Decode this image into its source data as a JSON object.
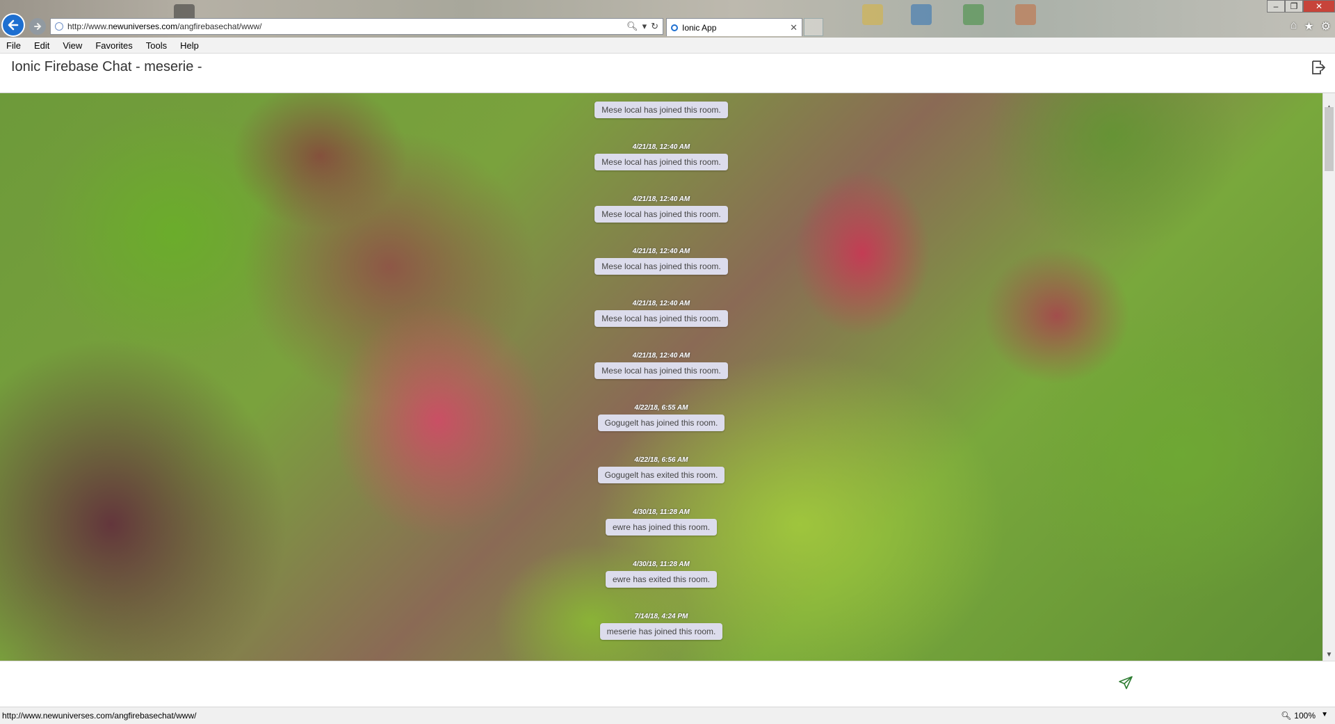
{
  "browser": {
    "url_prefix": "http://www.",
    "url_domain": "newuniverses.com",
    "url_path": "/angfirebasechat/www/",
    "tab_title": "Ionic App",
    "menu": [
      "File",
      "Edit",
      "View",
      "Favorites",
      "Tools",
      "Help"
    ],
    "status_url": "http://www.newuniverses.com/angfirebasechat/www/",
    "zoom": "100%"
  },
  "app": {
    "title": "Ionic Firebase Chat - meserie -"
  },
  "messages": [
    {
      "time": "",
      "text": "Mese local has joined this room."
    },
    {
      "time": "4/21/18, 12:40 AM",
      "text": "Mese local has joined this room."
    },
    {
      "time": "4/21/18, 12:40 AM",
      "text": "Mese local has joined this room."
    },
    {
      "time": "4/21/18, 12:40 AM",
      "text": "Mese local has joined this room."
    },
    {
      "time": "4/21/18, 12:40 AM",
      "text": "Mese local has joined this room."
    },
    {
      "time": "4/21/18, 12:40 AM",
      "text": "Mese local has joined this room."
    },
    {
      "time": "4/22/18, 6:55 AM",
      "text": "Gogugelt has joined this room."
    },
    {
      "time": "4/22/18, 6:56 AM",
      "text": "Gogugelt has exited this room."
    },
    {
      "time": "4/30/18, 11:28 AM",
      "text": "ewre has joined this room."
    },
    {
      "time": "4/30/18, 11:28 AM",
      "text": "ewre has exited this room."
    },
    {
      "time": "7/14/18, 4:24 PM",
      "text": "meserie has joined this room."
    }
  ],
  "input": {
    "placeholder": "",
    "value": ""
  },
  "icons": {
    "back": "arrow-left-icon",
    "forward": "arrow-right-icon",
    "logout": "sign-out-icon",
    "send": "paper-plane-icon"
  },
  "colors": {
    "accent": "#1e6fd0",
    "send_icon": "#2e7d32",
    "bubble": "#dcdcec"
  }
}
